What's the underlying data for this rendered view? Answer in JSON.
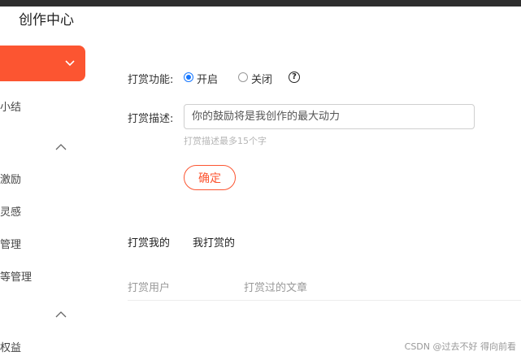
{
  "app": {
    "title": "创作中心"
  },
  "colors": {
    "accent": "#fc5531",
    "radio_active": "#1677ff"
  },
  "sidebar": {
    "items": [
      {
        "label": "小结"
      },
      {
        "label": "激励"
      },
      {
        "label": "灵感"
      },
      {
        "label": "管理"
      },
      {
        "label": "等管理"
      },
      {
        "label": "权益"
      }
    ]
  },
  "reward_form": {
    "function_label": "打赏功能:",
    "options": [
      {
        "label": "开启",
        "selected": true
      },
      {
        "label": "关闭",
        "selected": false
      }
    ],
    "help_icon": "?",
    "description_label": "打赏描述:",
    "description_placeholder": "你的鼓励将是我创作的最大动力",
    "description_hint": "打赏描述最多15个字",
    "confirm_label": "确定"
  },
  "tabs": [
    {
      "label": "打赏我的",
      "active": true
    },
    {
      "label": "我打赏的",
      "active": false
    }
  ],
  "table": {
    "columns": [
      "打赏用户",
      "打赏过的文章"
    ]
  },
  "watermark": "CSDN @过去不好 得向前看"
}
